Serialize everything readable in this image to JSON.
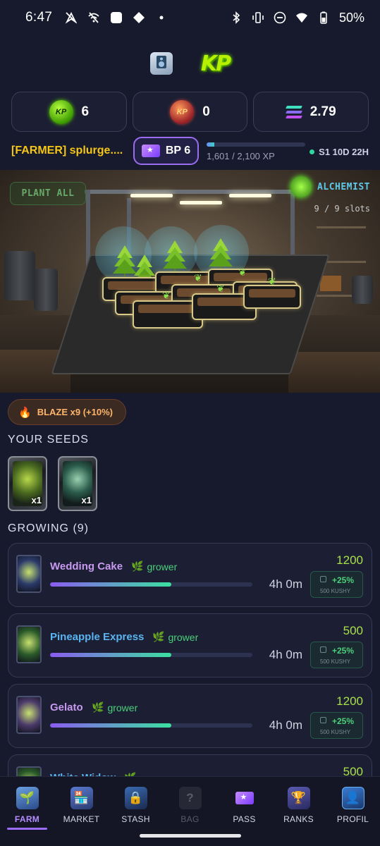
{
  "status_bar": {
    "time": "6:47",
    "battery": "50%",
    "left_icons": [
      "navigation-slash-icon",
      "wifi-off-icon",
      "app-square-icon",
      "diamond-icon",
      "dot-icon"
    ],
    "right_icons": [
      "bluetooth-icon",
      "vibrate-icon",
      "do-not-disturb-icon",
      "wifi-icon",
      "battery-icon"
    ]
  },
  "header": {
    "logo_text": "KP"
  },
  "currencies": [
    {
      "name": "kp-coin",
      "value": "6"
    },
    {
      "name": "kush-coin",
      "value": "0"
    },
    {
      "name": "solana",
      "value": "2.79"
    }
  ],
  "profile": {
    "player_name": "[FARMER] splurge....",
    "bp_label": "BP 6",
    "xp_text": "1,601 / 2,100 XP",
    "xp_fraction": 0.0,
    "season": "S1 10D 22H"
  },
  "farm": {
    "plant_all_label": "PLANT ALL",
    "role_label": "ALCHEMIST",
    "slots_text": "9 / 9 slots"
  },
  "boost": {
    "label": "BLAZE x9 (+10%)"
  },
  "seeds": {
    "title": "YOUR SEEDS",
    "items": [
      {
        "qty": "x1"
      },
      {
        "qty": "x1"
      }
    ]
  },
  "growing": {
    "title": "GROWING (9)",
    "items": [
      {
        "strain": "Wedding Cake",
        "role": "grower",
        "time": "4h 0m",
        "reward": "1200",
        "bonus": "+25%",
        "bonus_sub": "500 KUSHY",
        "progress": 0.6,
        "color": "#c79af0"
      },
      {
        "strain": "Pineapple Express",
        "role": "grower",
        "time": "4h 0m",
        "reward": "500",
        "bonus": "+25%",
        "bonus_sub": "500 KUSHY",
        "progress": 0.6,
        "color": "#5ab4f0"
      },
      {
        "strain": "Gelato",
        "role": "grower",
        "time": "4h 0m",
        "reward": "1200",
        "bonus": "+25%",
        "bonus_sub": "500 KUSHY",
        "progress": 0.6,
        "color": "#c79af0"
      },
      {
        "strain": "White Widow",
        "role": "grower",
        "time": "",
        "reward": "500",
        "bonus": "",
        "bonus_sub": "",
        "progress": 0.6,
        "color": "#5ab4f0"
      }
    ]
  },
  "nav": {
    "items": [
      {
        "label": "FARM",
        "icon": "farm-icon",
        "active": true
      },
      {
        "label": "MARKET",
        "icon": "market-icon"
      },
      {
        "label": "STASH",
        "icon": "stash-icon"
      },
      {
        "label": "BAG",
        "icon": "bag-icon",
        "disabled": true
      },
      {
        "label": "PASS",
        "icon": "ticket-icon"
      },
      {
        "label": "RANKS",
        "icon": "trophy-icon"
      },
      {
        "label": "PROFIL",
        "icon": "profile-icon"
      }
    ]
  },
  "colors": {
    "background": "#171a2c",
    "accent_purple": "#9c6cff",
    "gold": "#f5c518",
    "green": "#4ad07a",
    "cyan": "#5fc8e8"
  }
}
